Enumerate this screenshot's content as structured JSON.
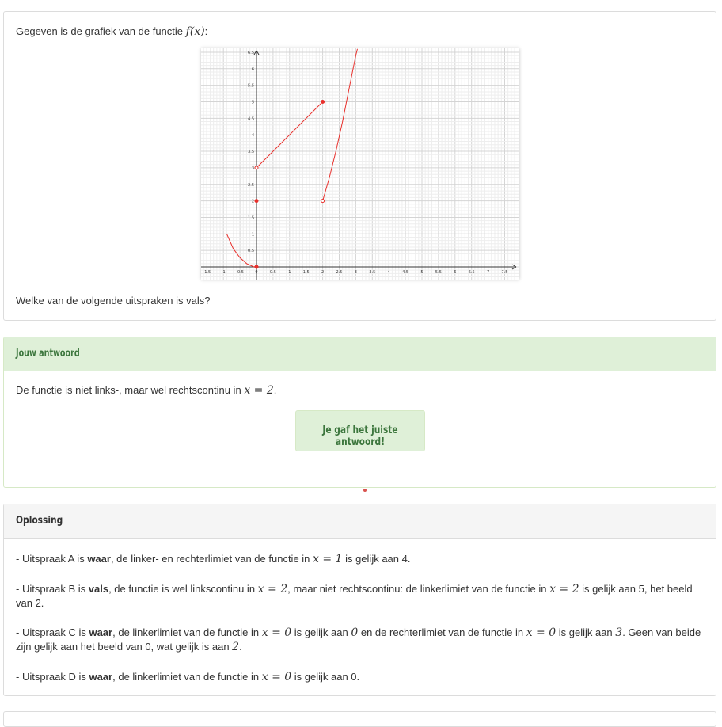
{
  "question": {
    "intro": "Gegeven is de grafiek van de functie",
    "func": "f(x)",
    "intro_end": ":",
    "prompt": "Welke van de volgende uitspraken is vals?"
  },
  "answer": {
    "header": "Jouw antwoord",
    "text": "De functie is niet links-, maar wel rechtscontinu in",
    "math": "x = 2",
    "end": ".",
    "feedback": "Je gaf het juiste antwoord!"
  },
  "solution": {
    "header": "Oplossing",
    "items": [
      {
        "pre": "- Uitspraak A is ",
        "bold": "waar",
        "rest": ", de linker- en rechterlimiet van de functie in ",
        "m1": "x = 1",
        "rest2": " is gelijk aan 4."
      },
      {
        "pre": "- Uitspraak B is ",
        "bold": "vals",
        "rest": ", de functie is wel linkscontinu in ",
        "m1": "x = 2",
        "rest2": ", maar niet rechtscontinu: de linkerlimiet van de functie in ",
        "m2": "x = 2",
        "rest3": " is gelijk aan 5, het beeld van 2."
      },
      {
        "pre": "- Uitspraak C is ",
        "bold": "waar",
        "rest": ", de linkerlimiet van de functie in ",
        "m1": "x = 0",
        "rest2": " is gelijk aan ",
        "m2": "0",
        "rest3": " en de rechterlimiet van de functie in ",
        "m3": "x = 0",
        "rest4": " is gelijk aan ",
        "m4": "3",
        "rest5": ". Geen van beide zijn gelijk aan het beeld van 0, wat gelijk is aan ",
        "m5": "2",
        "rest6": "."
      },
      {
        "pre": "- Uitspraak D is ",
        "bold": "waar",
        "rest": ", de linkerlimiet van de functie in ",
        "m1": "x = 0",
        "rest2": " is gelijk aan 0."
      }
    ]
  },
  "chart_data": {
    "type": "line",
    "xlim": [
      -1.6,
      7.8
    ],
    "ylim": [
      -0.35,
      6.5
    ],
    "grid": true,
    "x_ticks": [
      "-1.5",
      "-1",
      "-0.5",
      "0",
      "0.5",
      "1",
      "1.5",
      "2",
      "2.5",
      "3",
      "3.5",
      "4",
      "4.5",
      "5",
      "5.5",
      "6",
      "6.5",
      "7",
      "7.5"
    ],
    "y_ticks": [
      "0.5",
      "1",
      "1.5",
      "2",
      "2.5",
      "3",
      "3.5",
      "4",
      "4.5",
      "5",
      "5.5",
      "6",
      "6.5"
    ],
    "series": [
      {
        "points": [
          [
            -0.9,
            1.0
          ],
          [
            -0.7,
            0.55
          ],
          [
            -0.5,
            0.28
          ],
          [
            -0.3,
            0.1
          ],
          [
            -0.1,
            0.01
          ],
          [
            0,
            0
          ]
        ],
        "start": "none",
        "end": "open"
      },
      {
        "points": [
          [
            0,
            3
          ],
          [
            2,
            5
          ]
        ],
        "start": "open",
        "end": "closed"
      },
      {
        "points": [
          [
            2,
            2
          ],
          [
            2.2,
            2.7
          ],
          [
            2.4,
            3.5
          ],
          [
            2.6,
            4.4
          ],
          [
            2.8,
            5.4
          ],
          [
            3.0,
            6.4
          ],
          [
            3.05,
            6.6
          ]
        ],
        "start": "open",
        "end": "none"
      }
    ],
    "points": [
      {
        "x": 0,
        "y": 2,
        "style": "closed"
      },
      {
        "x": 0,
        "y": 0,
        "style": "closed"
      }
    ],
    "color": "#e8302c"
  }
}
